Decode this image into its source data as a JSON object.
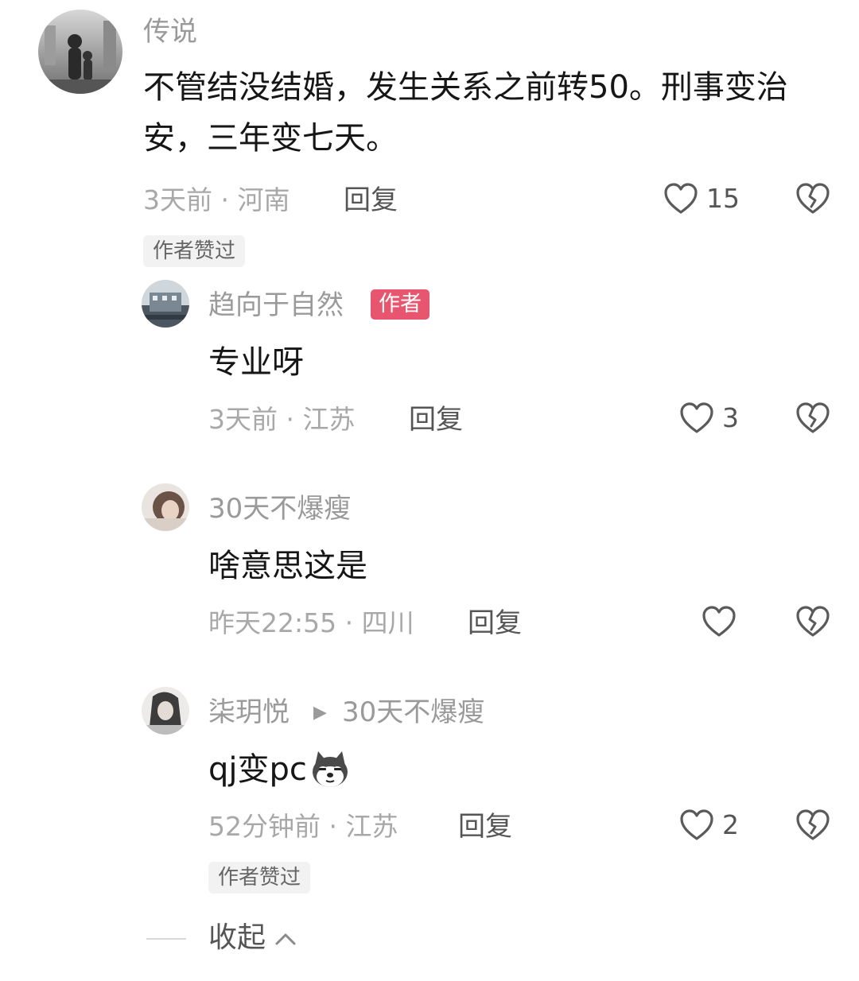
{
  "comments": [
    {
      "username": "传说",
      "text": "不管结没结婚，发生关系之前转50。刑事变治安，三年变七天。",
      "meta": "3天前 · 河南",
      "reply_label": "回复",
      "likes": "15",
      "badge": "作者赞过"
    },
    {
      "username": "趋向于自然",
      "tag": "作者",
      "text": "专业呀",
      "meta": "3天前 · 江苏",
      "reply_label": "回复",
      "likes": "3"
    },
    {
      "username": "30天不爆瘦",
      "text": "啥意思这是",
      "meta": "昨天22:55 · 四川",
      "reply_label": "回复",
      "likes": ""
    },
    {
      "username": "柒玥悦",
      "reply_to": "30天不爆瘦",
      "text": "qj变pc",
      "meta": "52分钟前 · 江苏",
      "reply_label": "回复",
      "likes": "2",
      "badge": "作者赞过"
    }
  ],
  "collapse_label": "收起",
  "icons": {
    "like": "heart-outline-icon",
    "dislike": "broken-heart-icon",
    "reply_arrow": "play-triangle-icon",
    "collapse": "chevron-up-icon",
    "emoji": "shiba-dog-emoji"
  },
  "colors": {
    "author_tag": "#e8556f",
    "username": "#9a9a9a",
    "meta": "#a8a8a8"
  }
}
